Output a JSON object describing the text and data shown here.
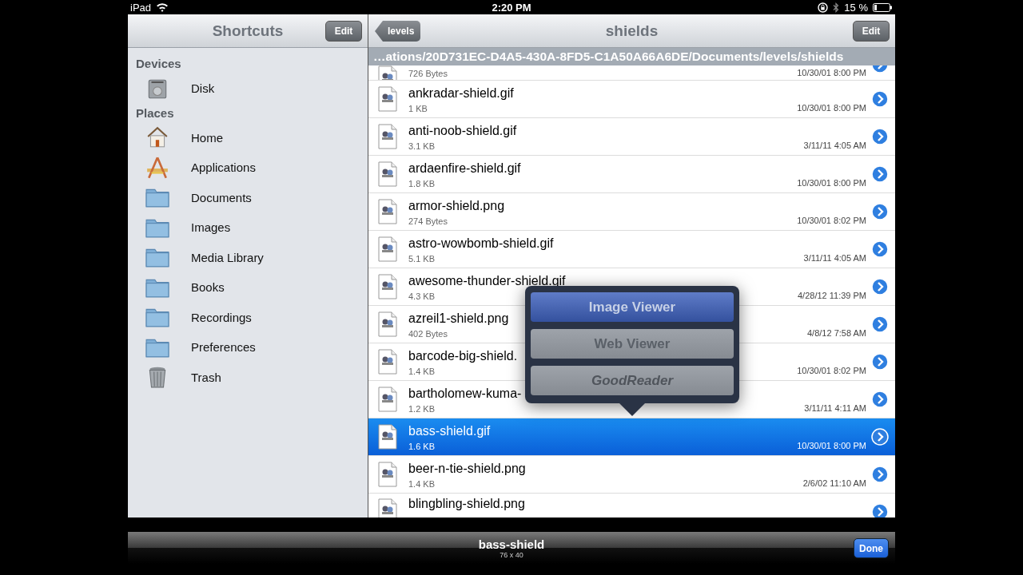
{
  "status_bar": {
    "device": "iPad",
    "time": "2:20 PM",
    "battery": "15 %"
  },
  "sidebar": {
    "title": "Shortcuts",
    "edit_button": "Edit",
    "sections": [
      {
        "title": "Devices",
        "items": [
          {
            "label": "Disk",
            "kind": "disk"
          }
        ]
      },
      {
        "title": "Places",
        "items": [
          {
            "label": "Home",
            "kind": "home"
          },
          {
            "label": "Applications",
            "kind": "apps"
          },
          {
            "label": "Documents",
            "kind": "folder"
          },
          {
            "label": "Images",
            "kind": "folder"
          },
          {
            "label": "Media Library",
            "kind": "folder"
          },
          {
            "label": "Books",
            "kind": "folder"
          },
          {
            "label": "Recordings",
            "kind": "folder"
          },
          {
            "label": "Preferences",
            "kind": "folder"
          },
          {
            "label": "Trash",
            "kind": "trash"
          }
        ]
      }
    ]
  },
  "browser": {
    "back_button": "levels",
    "title": "shields",
    "edit_button": "Edit",
    "path": "…ations/20D731EC-D4A5-430A-8FD5-C1A50A66A6DE/Documents/levels/shields",
    "files": [
      {
        "kind": "partial",
        "size": "726 Bytes",
        "date": "10/30/01 8:00 PM",
        "selected": false
      },
      {
        "kind": "full",
        "name": "ankradar-shield.gif",
        "size": "1 KB",
        "date": "10/30/01 8:00 PM",
        "selected": false
      },
      {
        "kind": "full",
        "name": "anti-noob-shield.gif",
        "size": "3.1 KB",
        "date": "3/11/11 4:05 AM",
        "selected": false
      },
      {
        "kind": "full",
        "name": "ardaenfire-shield.gif",
        "size": "1.8 KB",
        "date": "10/30/01 8:00 PM",
        "selected": false
      },
      {
        "kind": "full",
        "name": "armor-shield.png",
        "size": "274 Bytes",
        "date": "10/30/01 8:02 PM",
        "selected": false
      },
      {
        "kind": "full",
        "name": "astro-wowbomb-shield.gif",
        "size": "5.1 KB",
        "date": "3/11/11 4:05 AM",
        "selected": false
      },
      {
        "kind": "full",
        "name": "awesome-thunder-shield.gif",
        "size": "4.3 KB",
        "date": "4/28/12 11:39 PM",
        "selected": false
      },
      {
        "kind": "full",
        "name": "azreil1-shield.png",
        "size": "402 Bytes",
        "date": "4/8/12 7:58 AM",
        "selected": false
      },
      {
        "kind": "full",
        "name": "barcode-big-shield.",
        "size": "1.4 KB",
        "date": "10/30/01 8:02 PM",
        "selected": false
      },
      {
        "kind": "full",
        "name": "bartholomew-kuma-",
        "size": "1.2 KB",
        "date": "3/11/11 4:11 AM",
        "selected": false
      },
      {
        "kind": "full",
        "name": "bass-shield.gif",
        "size": "1.6 KB",
        "date": "10/30/01 8:00 PM",
        "selected": true
      },
      {
        "kind": "full",
        "name": "beer-n-tie-shield.png",
        "size": "1.4 KB",
        "date": "2/6/02 11:10 AM",
        "selected": false
      },
      {
        "kind": "cut",
        "name": "blingbling-shield.png",
        "selected": false
      }
    ]
  },
  "open_with_menu": {
    "options": [
      {
        "label": "Image Viewer",
        "selected": true,
        "disabled": false
      },
      {
        "label": "Web Viewer",
        "selected": false,
        "disabled": false
      },
      {
        "label": "GoodReader",
        "selected": false,
        "disabled": true
      }
    ]
  },
  "toolbar": {
    "title": "bass-shield",
    "subtitle": "76 x 40",
    "done_button": "Done"
  }
}
